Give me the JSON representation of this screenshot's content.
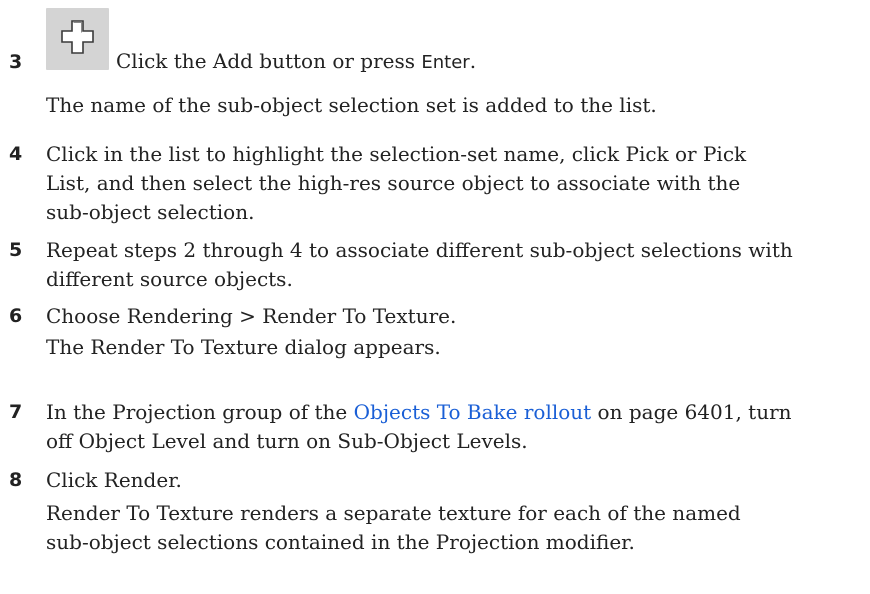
{
  "steps": [
    {
      "number": "3",
      "icon": "add-plus-icon",
      "text_before": "Click the Add button or press ",
      "key": "Enter",
      "text_after": ".",
      "result": "The name of the sub-object selection set is added to the list."
    },
    {
      "number": "4",
      "line1": "Click in the list to highlight the selection-set name, click Pick or Pick",
      "line2": "List, and then select the high-res source object to associate with the",
      "line3": "sub-object selection."
    },
    {
      "number": "5",
      "line1": "Repeat steps 2 through 4 to associate different sub-object selections with",
      "line2": "different source objects."
    },
    {
      "number": "6",
      "text": "Choose Rendering > Render To Texture.",
      "result": "The Render To Texture dialog appears."
    },
    {
      "number": "7",
      "text_before": "In the Projection group of the ",
      "link": "Objects To Bake rollout",
      "text_after": " on page 6401, turn",
      "line2": "off Object Level and turn on Sub-Object Levels."
    },
    {
      "number": "8",
      "text": "Click Render.",
      "result_line1": "Render To Texture renders a separate texture for each of the named",
      "result_line2": "sub-object selections contained in the Projection modifier."
    }
  ],
  "colors": {
    "link": "#1a5fd6",
    "text": "#222222",
    "button_bg": "#d4d4d4"
  }
}
